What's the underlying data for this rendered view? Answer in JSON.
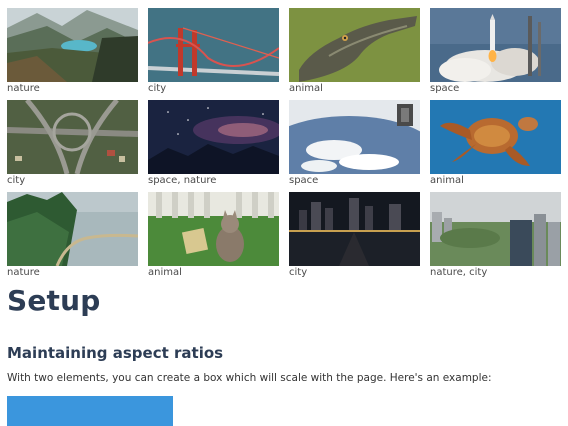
{
  "gallery": [
    {
      "caption": "nature",
      "scene": "mountain-lake"
    },
    {
      "caption": "city",
      "scene": "red-bridge"
    },
    {
      "caption": "animal",
      "scene": "alligator"
    },
    {
      "caption": "space",
      "scene": "rocket-launch"
    },
    {
      "caption": "city",
      "scene": "highway-interchange"
    },
    {
      "caption": "space, nature",
      "scene": "night-sky"
    },
    {
      "caption": "space",
      "scene": "earth-from-orbit"
    },
    {
      "caption": "animal",
      "scene": "sea-turtle"
    },
    {
      "caption": "nature",
      "scene": "forest-coast"
    },
    {
      "caption": "animal",
      "scene": "cat-on-grass"
    },
    {
      "caption": "city",
      "scene": "city-night-reflection"
    },
    {
      "caption": "nature, city",
      "scene": "park-skyline"
    }
  ],
  "section": {
    "title": "Setup",
    "subtitle": "Maintaining aspect ratios",
    "body": "With two elements, you can create a box which will scale with the page. Here's an example:"
  },
  "colors": {
    "heading": "#2d3d55",
    "demo_box": "#3b96dd"
  }
}
